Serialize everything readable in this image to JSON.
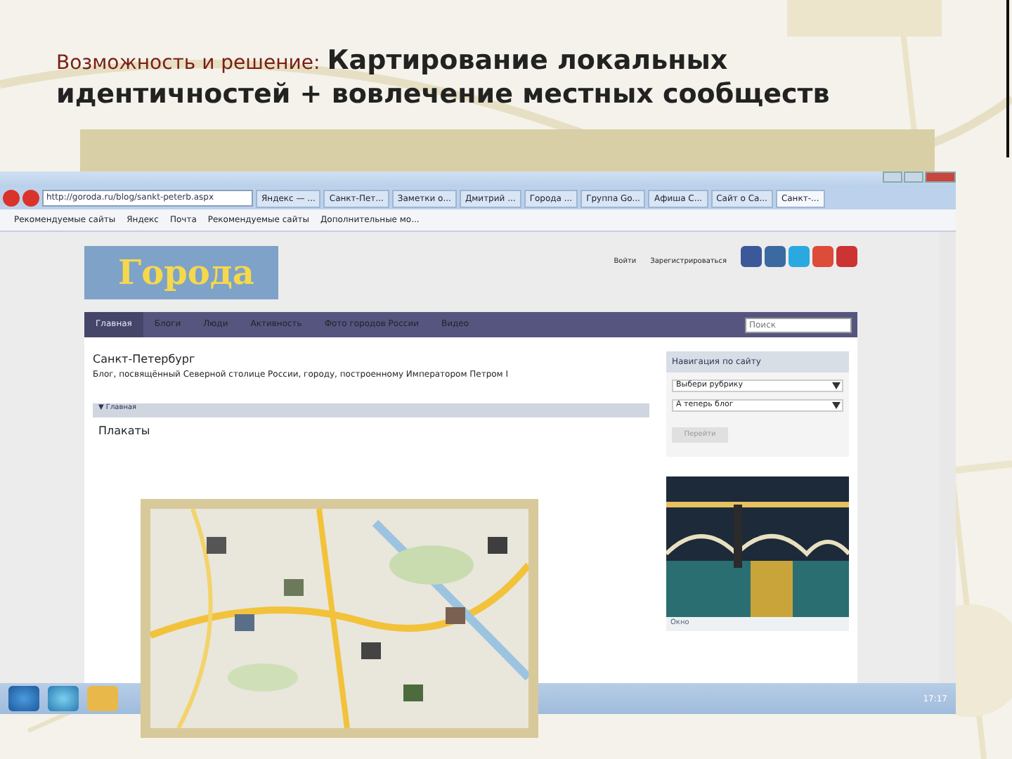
{
  "slide": {
    "title_lead": "Возможность и решение:",
    "title_rest": "Картирование локальных",
    "title_line2": "идентичностей + вовлечение местных сообществ"
  },
  "browser": {
    "url": "http://goroda.ru/blog/sankt-peterb.aspx",
    "tabs": [
      {
        "label": "Яндекс — ...",
        "selected": false
      },
      {
        "label": "Санкт-Пет...",
        "selected": false
      },
      {
        "label": "Заметки о...",
        "selected": false
      },
      {
        "label": "Дмитрий ...",
        "selected": false
      },
      {
        "label": "Города ...",
        "selected": false
      },
      {
        "label": "Группа Go...",
        "selected": false
      },
      {
        "label": "Афиша С...",
        "selected": false
      },
      {
        "label": "Сайт о Са...",
        "selected": false
      },
      {
        "label": "Санкт-...",
        "selected": true
      }
    ],
    "favorites": [
      "Рекомендуемые сайты",
      "Яндекс",
      "Почта",
      "Рекомендуемые сайты",
      "Дополнительные мо..."
    ]
  },
  "site": {
    "logo": "Города",
    "login_links": [
      "Войти",
      "Зарегистрироваться"
    ],
    "search": {
      "placeholder": "Поиск"
    },
    "nav": [
      {
        "label": "Главная",
        "selected": true
      },
      {
        "label": "Блоги",
        "selected": false
      },
      {
        "label": "Люди",
        "selected": false
      },
      {
        "label": "Активность",
        "selected": false
      },
      {
        "label": "Фото городов России",
        "selected": false
      },
      {
        "label": "Видео",
        "selected": false
      }
    ],
    "page_title": "Санкт-Петербург",
    "page_subtitle": "Блог, посвящённый Северной столице России, городу, построенному Императором Петром I",
    "section": "▼ Главная",
    "post_title": "Плакаты",
    "sidebar": {
      "title": "Навигация по сайту",
      "selects": [
        "Выбери рубрику",
        "А теперь блог"
      ],
      "button": "Перейти"
    },
    "photo_caption": "Окно"
  },
  "taskbar": {
    "time": "17:17"
  }
}
